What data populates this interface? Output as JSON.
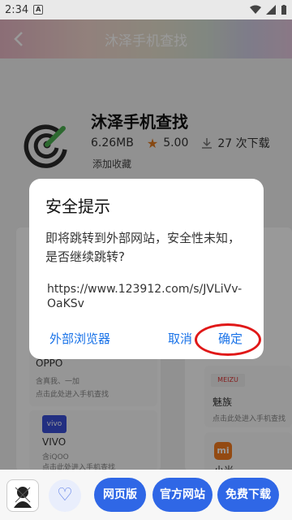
{
  "status_bar": {
    "time": "2:34",
    "app_badge": "A"
  },
  "header": {
    "title": "沐泽手机查找"
  },
  "app": {
    "name": "沐泽手机查找",
    "size": "6.26MB",
    "rating": "5.00",
    "downloads": "27 次下载",
    "favorite_label": "添加收藏"
  },
  "cards": {
    "oppo": {
      "title": "OPPO",
      "subtitle": "含真我、一加",
      "hint": "点击此处进入手机查找"
    },
    "vivo": {
      "logo": "vivo",
      "title": "VIVO",
      "subtitle": "含iQOO",
      "hint": "点击此处进入手机查找"
    },
    "meizu": {
      "logo": "MEIZU",
      "title": "魅族",
      "hint": "点击此处进入手机查找"
    },
    "xiaomi": {
      "logo": "mi",
      "title": "小米"
    }
  },
  "dialog": {
    "title": "安全提示",
    "message": "即将跳转到外部网站，安全性未知，是否继续跳转?",
    "url": "https://www.123912.com/s/JVLiVv-OaKSv",
    "browser_button": "外部浏览器",
    "cancel_button": "取消",
    "ok_button": "确定"
  },
  "bottom_bar": {
    "web_version": "网页版",
    "official_site": "官方网站",
    "free_download": "免费下载"
  },
  "colors": {
    "accent": "#2f67e6",
    "dialog_button": "#1a73e8",
    "highlight_ring": "#e01818",
    "star": "#e0781f"
  }
}
